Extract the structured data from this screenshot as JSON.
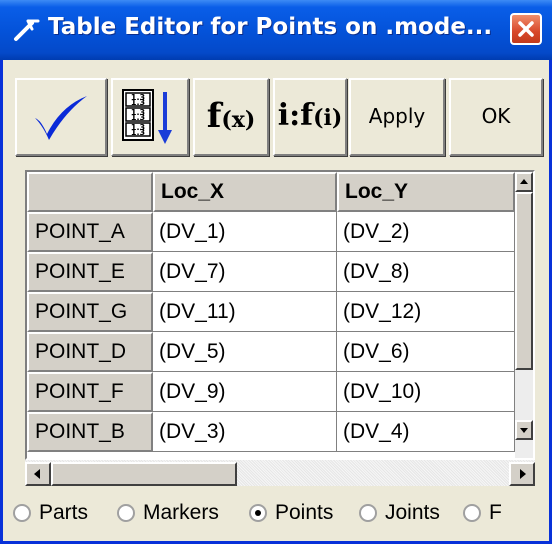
{
  "window": {
    "title": "Table Editor for Points on .mode...",
    "title_icon": "tool-icon",
    "close_icon": "close-icon",
    "accent_color": "#0453da"
  },
  "toolbar": {
    "checkmark_icon": "checkmark-icon",
    "sort_icon": "column-sort-icon",
    "fx_label": "f(x)",
    "fx_main": "f",
    "fx_sub": "(x)",
    "ifi_main": "i:f",
    "ifi_sub": "(i)",
    "apply_label": "Apply",
    "ok_label": "OK"
  },
  "table": {
    "columns": [
      "Loc_X",
      "Loc_Y"
    ],
    "rows": [
      {
        "name": "POINT_A",
        "loc_x": "(DV_1)",
        "loc_y": "(DV_2)"
      },
      {
        "name": "POINT_E",
        "loc_x": "(DV_7)",
        "loc_y": "(DV_8)"
      },
      {
        "name": "POINT_G",
        "loc_x": "(DV_11)",
        "loc_y": "(DV_12)"
      },
      {
        "name": "POINT_D",
        "loc_x": "(DV_5)",
        "loc_y": "(DV_6)"
      },
      {
        "name": "POINT_F",
        "loc_x": "(DV_9)",
        "loc_y": "(DV_10)"
      },
      {
        "name": "POINT_B",
        "loc_x": "(DV_3)",
        "loc_y": "(DV_4)"
      }
    ]
  },
  "object_type": {
    "options": [
      "Parts",
      "Markers",
      "Points",
      "Joints",
      "F"
    ],
    "selected": "Points"
  }
}
